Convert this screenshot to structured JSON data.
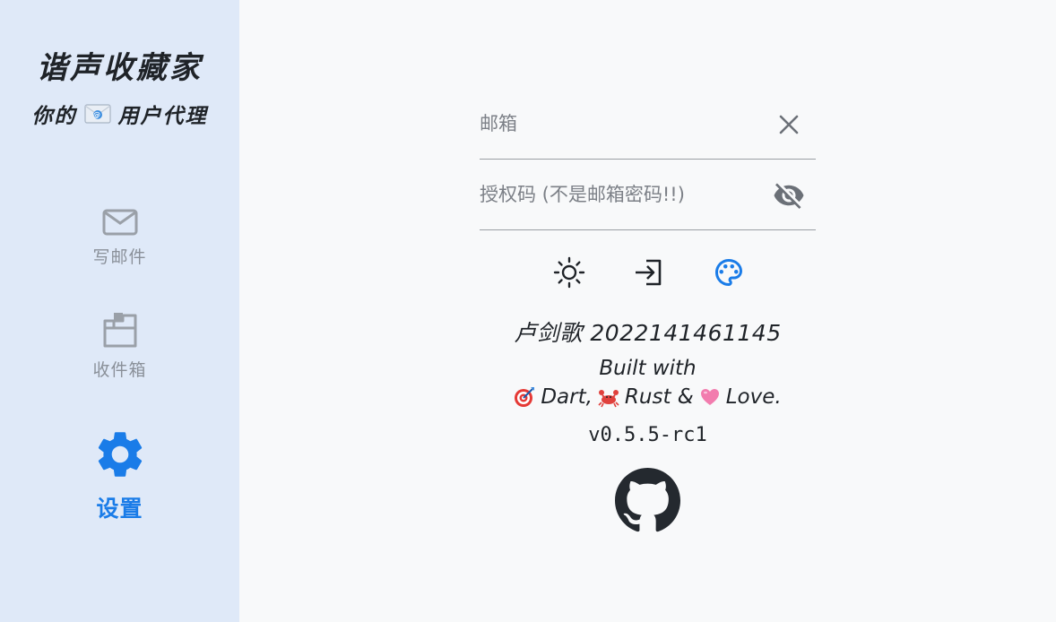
{
  "sidebar": {
    "title": "谐声收藏家",
    "subtitle_before": "你的",
    "subtitle_after": "用户代理",
    "subtitle_icon": "envelope-emoji",
    "nav": [
      {
        "label": "写邮件",
        "icon": "mail-icon",
        "active": false
      },
      {
        "label": "收件箱",
        "icon": "inbox-folder-icon",
        "active": false
      },
      {
        "label": "设置",
        "icon": "gear-icon",
        "active": true
      }
    ]
  },
  "form": {
    "email": {
      "placeholder": "邮箱",
      "value": "",
      "suffix_icon": "close-icon"
    },
    "auth_code": {
      "placeholder": "授权码 (不是邮箱密码!!)",
      "value": "",
      "suffix_icon": "eye-off-icon"
    }
  },
  "toolbar": [
    {
      "icon": "brightness-icon"
    },
    {
      "icon": "login-icon"
    },
    {
      "icon": "palette-icon"
    }
  ],
  "about": {
    "author": "卢剑歌 2022141461145",
    "built_line1": "Built with",
    "dart": "Dart,",
    "rust": "Rust &",
    "love": "Love.",
    "version": "v0.5.5-rc1",
    "github_icon": "github-icon"
  },
  "colors": {
    "sidebar_bg": "#dfe9f8",
    "main_bg": "#f8f9fa",
    "accent": "#1a7ce8",
    "inactive": "#9aa0a8"
  }
}
